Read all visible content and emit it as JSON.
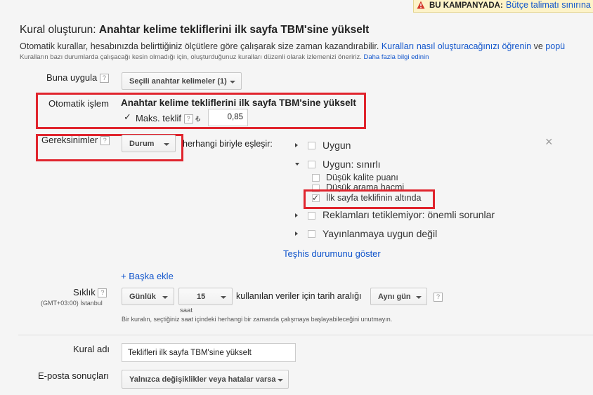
{
  "notice": {
    "label": "BU KAMPANYADA:",
    "link": "Bütçe talimatı sınırına"
  },
  "header": {
    "title_prefix": "Kural oluşturun: ",
    "title_bold": "Anahtar kelime tekliflerini ilk sayfa TBM'sine yükselt",
    "desc_text": "Otomatik kurallar, hesabınızda belirttiğiniz ölçütlere göre çalışarak size zaman kazandırabilir. ",
    "desc_link1": "Kuralları nasıl oluşturacağınızı öğrenin",
    "desc_and": " ve ",
    "desc_link2": "popü",
    "note_text": "Kuralların bazı durumlarda çalışacağı kesin olmadığı için, oluşturduğunuz kuralları düzenli olarak izlemenizi öneririz. ",
    "note_link": "Daha fazla bilgi edinin"
  },
  "apply": {
    "label": "Buna uygula",
    "help": "?",
    "dropdown": "Seçili anahtar kelimeler (1)"
  },
  "action": {
    "label": "Otomatik işlem",
    "title": "Anahtar kelime tekliflerini ilk sayfa TBM'sine yükselt",
    "max_bid_label": "Maks. teklif",
    "help": "?",
    "currency": "₺",
    "max_bid_value": "0,85"
  },
  "requirements": {
    "label": "Gereksinimler",
    "help": "?",
    "dropdown": "Durum",
    "match_text": "herhangi biriyle eşleşir:",
    "options": [
      {
        "label": "Uygun"
      },
      {
        "label": "Uygun: sınırlı"
      },
      {
        "label": "Düşük kalite puanı"
      },
      {
        "label": "Düşük arama hacmi"
      },
      {
        "label": "İlk sayfa teklifinin altında"
      },
      {
        "label": "Reklamları tetiklemiyor: önemli sorunlar"
      },
      {
        "label": "Yayınlanmaya uygun değil"
      }
    ],
    "diagnose_link": "Teşhis durumunu göster",
    "add_more": "+ Başka ekle",
    "close": "×"
  },
  "frequency": {
    "label": "Sıklık",
    "help": "?",
    "timezone": "(GMT+03:00) İstanbul",
    "period": "Günlük",
    "hour": "15",
    "hour_label": "saat",
    "data_text": "kullanılan veriler için tarih aralığı",
    "range": "Aynı gün",
    "help2": "?",
    "note": "Bir kuralın, seçtiğiniz saat içindeki herhangi bir zamanda çalışmaya başlayabileceğini unutmayın."
  },
  "rule_name": {
    "label": "Kural adı",
    "value": "Teklifleri ilk sayfa TBM'sine yükselt"
  },
  "email": {
    "label": "E-posta sonuçları",
    "dropdown": "Yalnızca değişiklikler veya hatalar varsa"
  }
}
